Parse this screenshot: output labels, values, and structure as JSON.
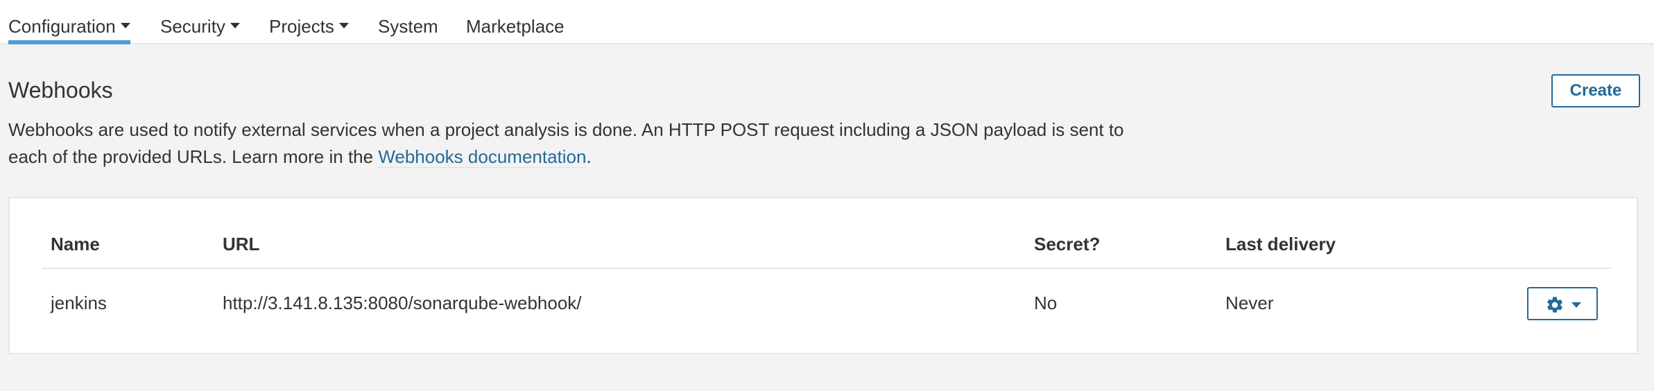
{
  "nav": {
    "items": [
      {
        "label": "Configuration",
        "dropdown": true,
        "active": true
      },
      {
        "label": "Security",
        "dropdown": true
      },
      {
        "label": "Projects",
        "dropdown": true
      },
      {
        "label": "System",
        "dropdown": false
      },
      {
        "label": "Marketplace",
        "dropdown": false
      }
    ]
  },
  "page": {
    "title": "Webhooks",
    "create_label": "Create",
    "description_before_link": "Webhooks are used to notify external services when a project analysis is done. An HTTP POST request including a JSON payload is sent to each of the provided URLs. Learn more in the ",
    "description_link": "Webhooks documentation",
    "description_after_link": "."
  },
  "table": {
    "headers": {
      "name": "Name",
      "url": "URL",
      "secret": "Secret?",
      "last_delivery": "Last delivery"
    },
    "rows": [
      {
        "name": "jenkins",
        "url": "http://3.141.8.135:8080/sonarqube-webhook/",
        "secret": "No",
        "last_delivery": "Never",
        "actions_icon": "gear-icon"
      }
    ]
  },
  "colors": {
    "accent": "#236a97",
    "active_tab_underline": "#4b9fd5",
    "page_background": "#f3f3f3"
  }
}
